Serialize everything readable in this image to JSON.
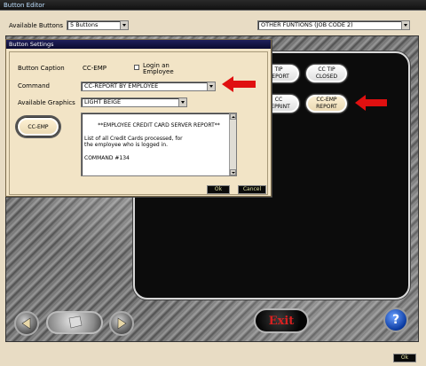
{
  "window": {
    "title": "Button Editor"
  },
  "top": {
    "available_buttons_label": "Available Buttons",
    "available_buttons_value": "5 Buttons",
    "category_value": "OTHER FUNTIONS (JOB CODE 2)"
  },
  "dialog": {
    "title": "Button Settings",
    "caption_label": "Button Caption",
    "caption_value": "CC-EMP",
    "login_label": "Login an Employee",
    "command_label": "Command",
    "command_value": "CC-REPORT BY EMPLOYEE",
    "graphics_label": "Available Graphics",
    "graphics_value": "LIGHT BEIGE",
    "preview_label": "CC-EMP",
    "description": "  **EMPLOYEE CREDIT CARD SERVER REPORT**\n\nList of all Credit Cards processed, for\nthe employee who is logged in.\n\nCOMMAND #134",
    "ok_label": "Ok",
    "cancel_label": "Cancel"
  },
  "screen_buttons": {
    "b1": "TIP\nREPORT",
    "b2": "CC TIP\nCLOSED",
    "b3": "CC\nREPRINT",
    "b4": "CC-EMP\nREPORT"
  },
  "nav": {
    "exit_label": "Exit",
    "help_label": "?"
  },
  "footer": {
    "ok_label": "Ok"
  },
  "colors": {
    "arrow_red": "#e01010",
    "dialog_bg": "#f2e4c6",
    "screen_bg": "#0c0c0c"
  }
}
